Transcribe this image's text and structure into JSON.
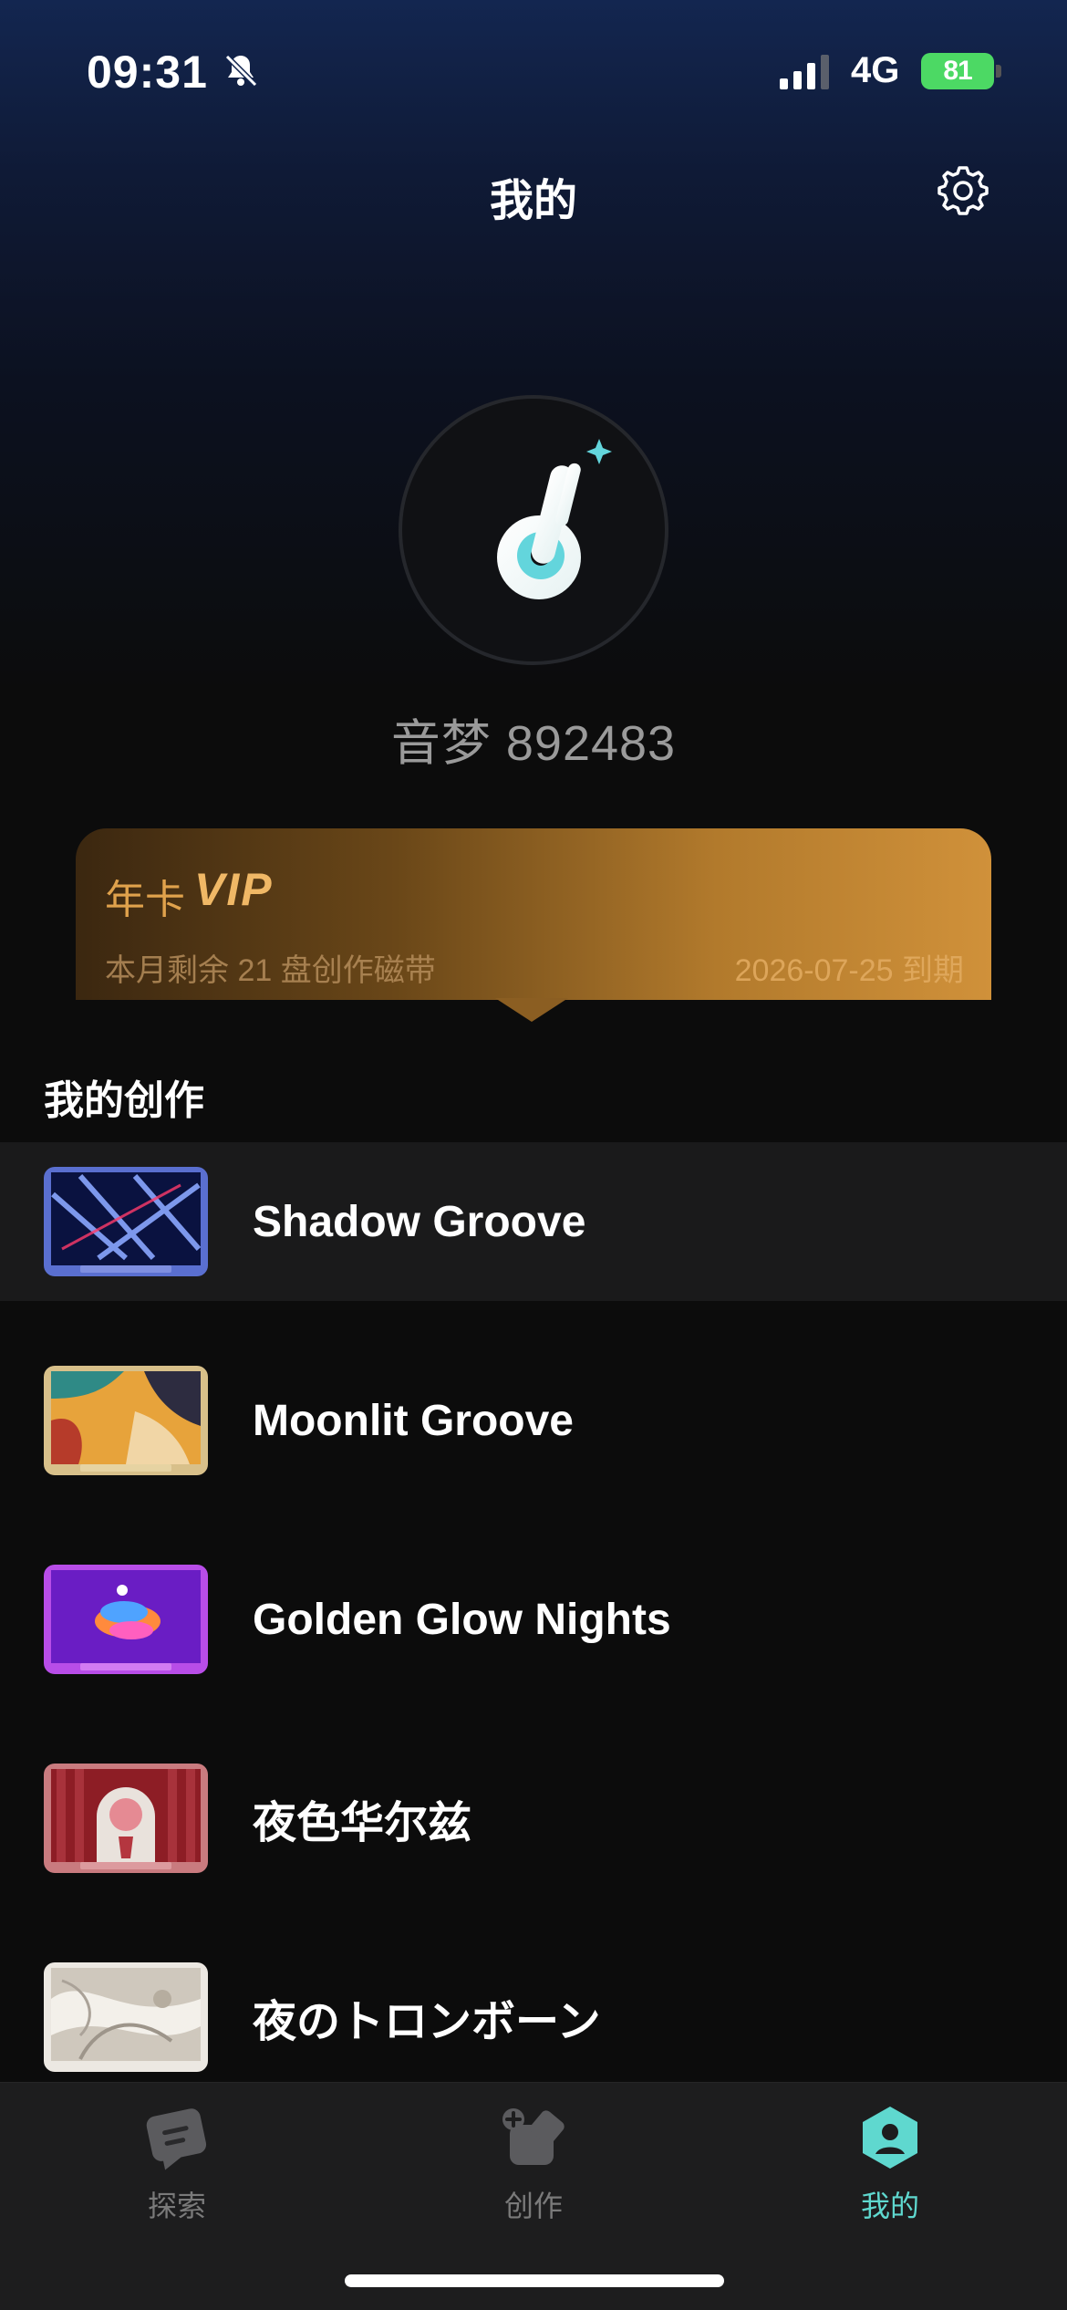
{
  "status_bar": {
    "time": "09:31",
    "network": "4G",
    "battery": "81"
  },
  "header": {
    "title": "我的"
  },
  "profile": {
    "username": "音梦 892483"
  },
  "vip": {
    "title": "年卡",
    "badge": "VIP",
    "remaining": "本月剩余 21 盘创作磁带",
    "expiry": "2026-07-25 到期"
  },
  "creations": {
    "section_title": "我的创作",
    "items": [
      {
        "title": "Shadow Groove"
      },
      {
        "title": "Moonlit Groove"
      },
      {
        "title": "Golden Glow Nights"
      },
      {
        "title": "夜色华尔兹"
      },
      {
        "title": "夜のトロンボーン"
      }
    ]
  },
  "tabs": [
    {
      "label": "探索"
    },
    {
      "label": "创作"
    },
    {
      "label": "我的"
    }
  ],
  "colors": {
    "accent": "#5fd8cf",
    "gold": "#d0913a",
    "background": "#0c0c0c"
  }
}
